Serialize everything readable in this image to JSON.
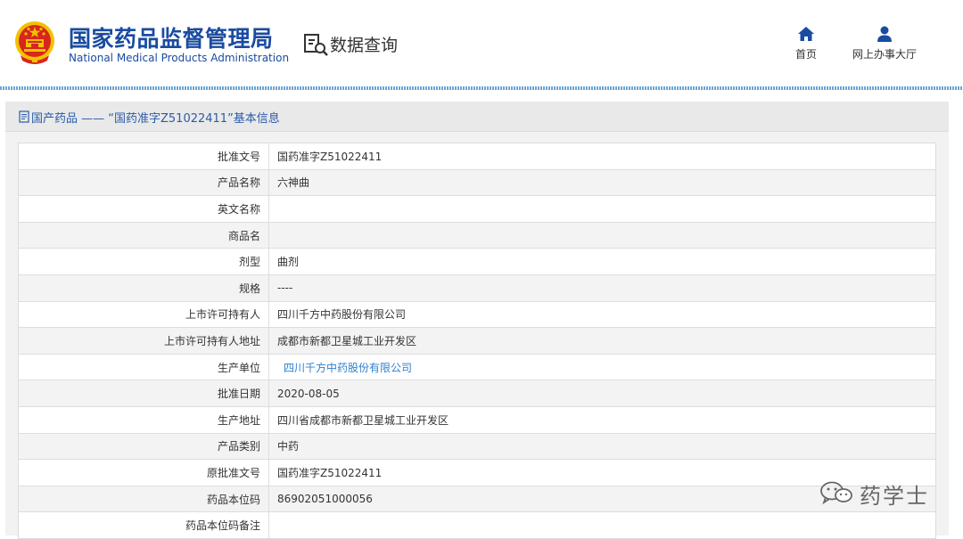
{
  "header": {
    "org_name_cn": "国家药品监督管理局",
    "org_name_en": "National Medical Products Administration",
    "query_label": "数据查询",
    "nav": {
      "home_label": "首页",
      "online_hall_label": "网上办事大厅"
    }
  },
  "panel": {
    "title": "国产药品 —— “国药准字Z51022411”基本信息"
  },
  "records": [
    {
      "label": "批准文号",
      "value": "国药准字Z51022411"
    },
    {
      "label": "产品名称",
      "value": "六神曲"
    },
    {
      "label": "英文名称",
      "value": ""
    },
    {
      "label": "商品名",
      "value": ""
    },
    {
      "label": "剂型",
      "value": "曲剂"
    },
    {
      "label": "规格",
      "value": "----"
    },
    {
      "label": "上市许可持有人",
      "value": "四川千方中药股份有限公司"
    },
    {
      "label": "上市许可持有人地址",
      "value": "成都市新都卫星城工业开发区"
    },
    {
      "label": "生产单位",
      "value": "四川千方中药股份有限公司"
    },
    {
      "label": "批准日期",
      "value": "2020-08-05"
    },
    {
      "label": "生产地址",
      "value": "四川省成都市新都卫星城工业开发区"
    },
    {
      "label": "产品类别",
      "value": "中药"
    },
    {
      "label": "原批准文号",
      "value": "国药准字Z51022411"
    },
    {
      "label": "药品本位码",
      "value": "86902051000056"
    },
    {
      "label": "药品本位码备注",
      "value": ""
    }
  ],
  "watermark": {
    "text": "药学士"
  },
  "colors": {
    "brand_blue": "#1a4ba0",
    "link_blue": "#2f7fd0",
    "emblem_red": "#d8261c",
    "emblem_gold": "#f2c200"
  }
}
